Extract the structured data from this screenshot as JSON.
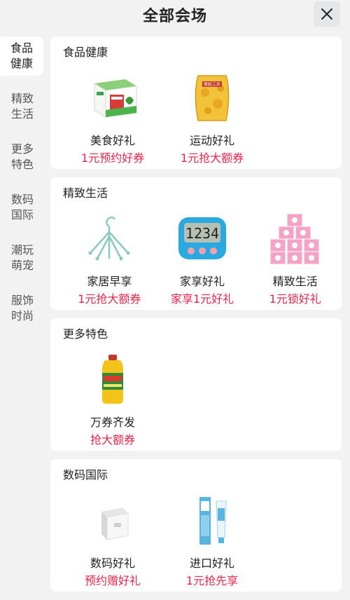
{
  "header": {
    "title": "全部会场"
  },
  "sidebar": {
    "items": [
      {
        "line1": "食品",
        "line2": "健康"
      },
      {
        "line1": "精致",
        "line2": "生活"
      },
      {
        "line1": "更多",
        "line2": "特色"
      },
      {
        "line1": "数码",
        "line2": "国际"
      },
      {
        "line1": "潮玩",
        "line2": "萌宠"
      },
      {
        "line1": "服饰",
        "line2": "时尚"
      }
    ]
  },
  "sections": [
    {
      "title": "食品健康",
      "items": [
        {
          "name": "美食好礼",
          "promo": "1元预约好券",
          "icon": "tea-gift-box-icon"
        },
        {
          "name": "运动好礼",
          "promo": "1元抢大额券",
          "icon": "snack-bag-icon",
          "label": "笑脸三乐"
        }
      ]
    },
    {
      "title": "精致生活",
      "items": [
        {
          "name": "家居早享",
          "promo": "1元抢大额券",
          "icon": "clothes-hanger-icon"
        },
        {
          "name": "家享好礼",
          "promo": "家享1元好礼",
          "icon": "kitchen-timer-icon",
          "label": "1234"
        },
        {
          "name": "精致生活",
          "promo": "1元锁好礼",
          "icon": "tissue-stack-icon"
        }
      ]
    },
    {
      "title": "更多特色",
      "items": [
        {
          "name": "万券齐发",
          "promo": "抢大额券",
          "icon": "oil-bottle-icon"
        }
      ]
    },
    {
      "title": "数码国际",
      "items": [
        {
          "name": "数码好礼",
          "promo": "预约赠好礼",
          "icon": "power-adapter-icon"
        },
        {
          "name": "进口好礼",
          "promo": "1元抢先享",
          "icon": "toothpaste-icon"
        }
      ]
    }
  ],
  "colors": {
    "promo": "#e5264a",
    "background": "#f2f2f2",
    "card": "#ffffff"
  }
}
